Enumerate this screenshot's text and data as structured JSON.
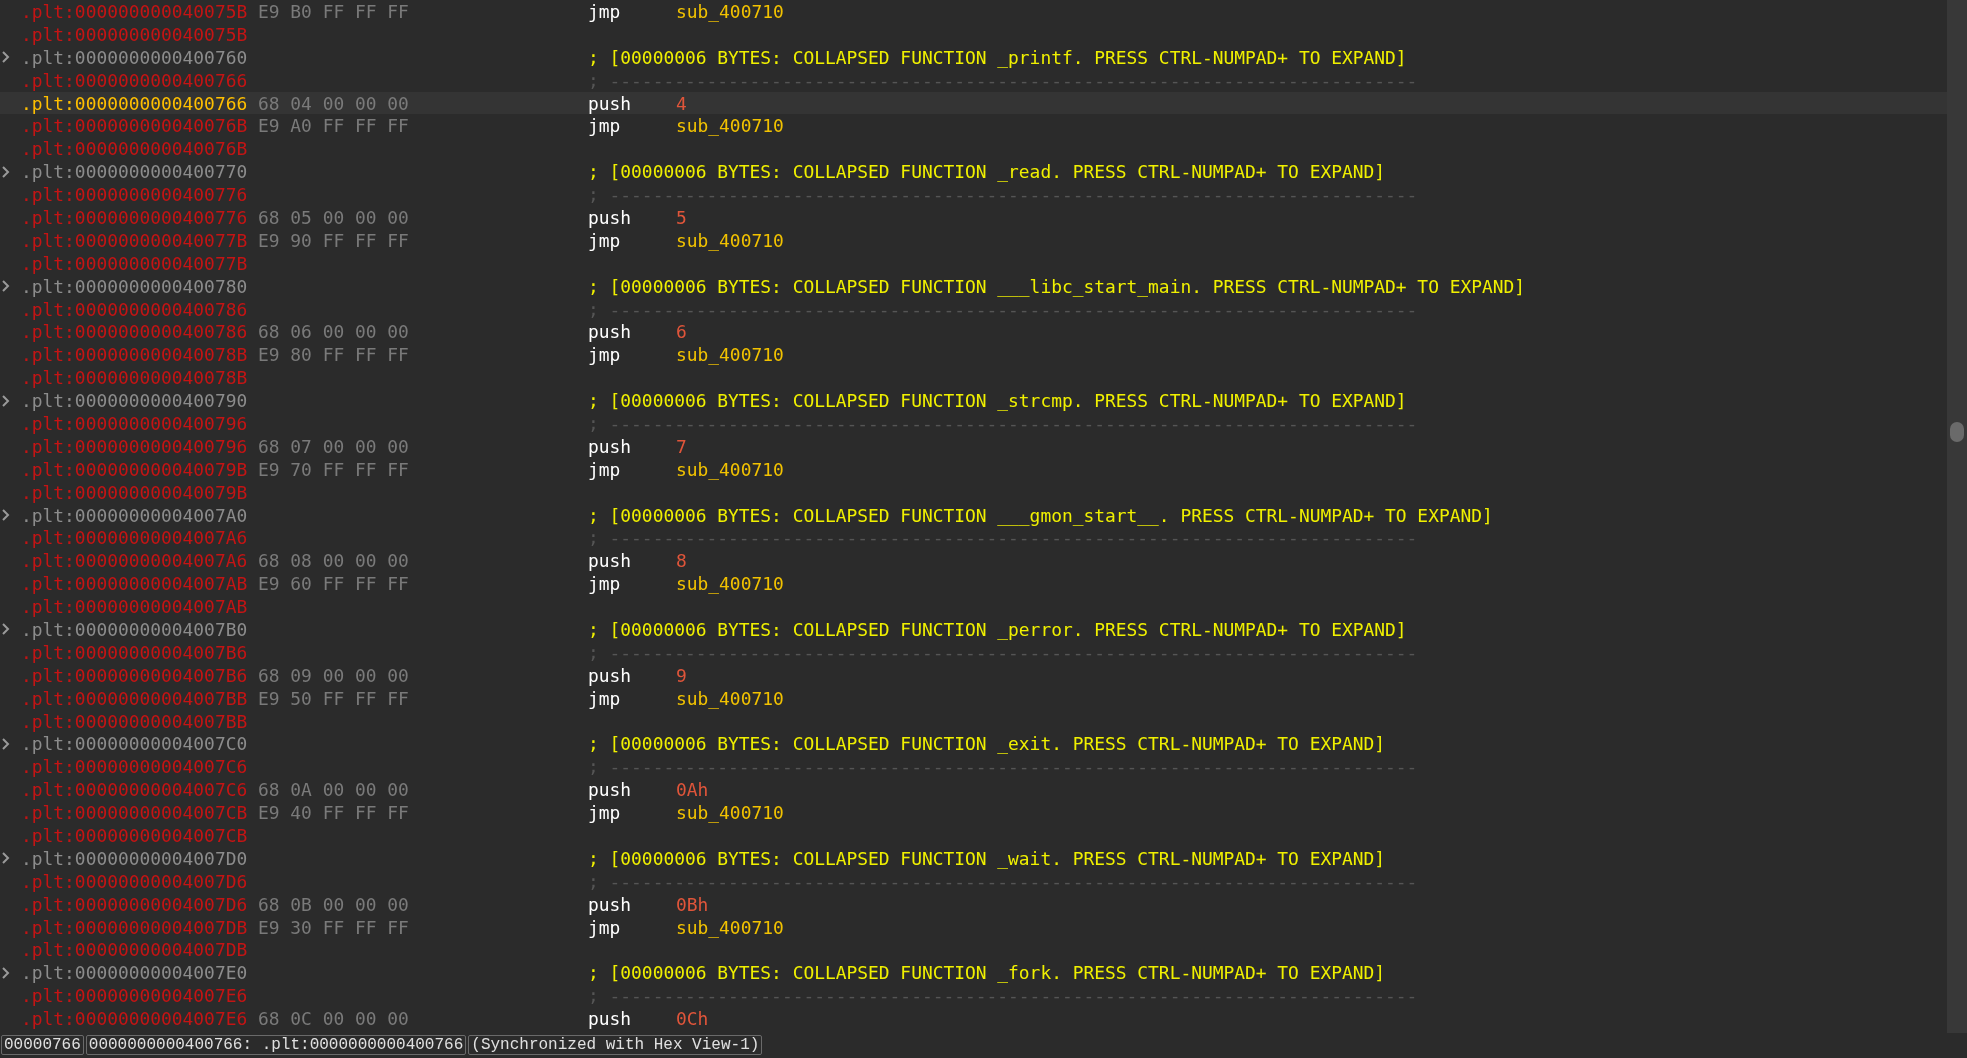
{
  "listing": {
    "rows": [
      {
        "kind": "instruction",
        "address": ".plt:000000000040075B",
        "bytes": "E9 B0 FF FF FF",
        "mnemonic": "jmp",
        "operand": {
          "kind": "name",
          "text": "sub_400710"
        },
        "selected": false
      },
      {
        "kind": "blank",
        "address": ".plt:000000000040075B",
        "selected": false
      },
      {
        "kind": "header",
        "address": ".plt:0000000000400760",
        "comment": "; [00000006 BYTES: COLLAPSED FUNCTION _printf. PRESS CTRL-NUMPAD+ TO EXPAND]",
        "selected": false
      },
      {
        "kind": "separator",
        "address": ".plt:0000000000400766",
        "comment": "; ---------------------------------------------------------------------------",
        "selected": false
      },
      {
        "kind": "instruction",
        "address": ".plt:0000000000400766",
        "bytes": "68 04 00 00 00",
        "mnemonic": "push",
        "operand": {
          "kind": "number",
          "text": "4"
        },
        "selected": true
      },
      {
        "kind": "instruction",
        "address": ".plt:000000000040076B",
        "bytes": "E9 A0 FF FF FF",
        "mnemonic": "jmp",
        "operand": {
          "kind": "name",
          "text": "sub_400710"
        },
        "selected": false
      },
      {
        "kind": "blank",
        "address": ".plt:000000000040076B",
        "selected": false
      },
      {
        "kind": "header",
        "address": ".plt:0000000000400770",
        "comment": "; [00000006 BYTES: COLLAPSED FUNCTION _read. PRESS CTRL-NUMPAD+ TO EXPAND]",
        "selected": false
      },
      {
        "kind": "separator",
        "address": ".plt:0000000000400776",
        "comment": "; ---------------------------------------------------------------------------",
        "selected": false
      },
      {
        "kind": "instruction",
        "address": ".plt:0000000000400776",
        "bytes": "68 05 00 00 00",
        "mnemonic": "push",
        "operand": {
          "kind": "number",
          "text": "5"
        },
        "selected": false
      },
      {
        "kind": "instruction",
        "address": ".plt:000000000040077B",
        "bytes": "E9 90 FF FF FF",
        "mnemonic": "jmp",
        "operand": {
          "kind": "name",
          "text": "sub_400710"
        },
        "selected": false
      },
      {
        "kind": "blank",
        "address": ".plt:000000000040077B",
        "selected": false
      },
      {
        "kind": "header",
        "address": ".plt:0000000000400780",
        "comment": "; [00000006 BYTES: COLLAPSED FUNCTION ___libc_start_main. PRESS CTRL-NUMPAD+ TO EXPAND]",
        "selected": false
      },
      {
        "kind": "separator",
        "address": ".plt:0000000000400786",
        "comment": "; ---------------------------------------------------------------------------",
        "selected": false
      },
      {
        "kind": "instruction",
        "address": ".plt:0000000000400786",
        "bytes": "68 06 00 00 00",
        "mnemonic": "push",
        "operand": {
          "kind": "number",
          "text": "6"
        },
        "selected": false
      },
      {
        "kind": "instruction",
        "address": ".plt:000000000040078B",
        "bytes": "E9 80 FF FF FF",
        "mnemonic": "jmp",
        "operand": {
          "kind": "name",
          "text": "sub_400710"
        },
        "selected": false
      },
      {
        "kind": "blank",
        "address": ".plt:000000000040078B",
        "selected": false
      },
      {
        "kind": "header",
        "address": ".plt:0000000000400790",
        "comment": "; [00000006 BYTES: COLLAPSED FUNCTION _strcmp. PRESS CTRL-NUMPAD+ TO EXPAND]",
        "selected": false
      },
      {
        "kind": "separator",
        "address": ".plt:0000000000400796",
        "comment": "; ---------------------------------------------------------------------------",
        "selected": false
      },
      {
        "kind": "instruction",
        "address": ".plt:0000000000400796",
        "bytes": "68 07 00 00 00",
        "mnemonic": "push",
        "operand": {
          "kind": "number",
          "text": "7"
        },
        "selected": false
      },
      {
        "kind": "instruction",
        "address": ".plt:000000000040079B",
        "bytes": "E9 70 FF FF FF",
        "mnemonic": "jmp",
        "operand": {
          "kind": "name",
          "text": "sub_400710"
        },
        "selected": false
      },
      {
        "kind": "blank",
        "address": ".plt:000000000040079B",
        "selected": false
      },
      {
        "kind": "header",
        "address": ".plt:00000000004007A0",
        "comment": "; [00000006 BYTES: COLLAPSED FUNCTION ___gmon_start__. PRESS CTRL-NUMPAD+ TO EXPAND]",
        "selected": false
      },
      {
        "kind": "separator",
        "address": ".plt:00000000004007A6",
        "comment": "; ---------------------------------------------------------------------------",
        "selected": false
      },
      {
        "kind": "instruction",
        "address": ".plt:00000000004007A6",
        "bytes": "68 08 00 00 00",
        "mnemonic": "push",
        "operand": {
          "kind": "number",
          "text": "8"
        },
        "selected": false
      },
      {
        "kind": "instruction",
        "address": ".plt:00000000004007AB",
        "bytes": "E9 60 FF FF FF",
        "mnemonic": "jmp",
        "operand": {
          "kind": "name",
          "text": "sub_400710"
        },
        "selected": false
      },
      {
        "kind": "blank",
        "address": ".plt:00000000004007AB",
        "selected": false
      },
      {
        "kind": "header",
        "address": ".plt:00000000004007B0",
        "comment": "; [00000006 BYTES: COLLAPSED FUNCTION _perror. PRESS CTRL-NUMPAD+ TO EXPAND]",
        "selected": false
      },
      {
        "kind": "separator",
        "address": ".plt:00000000004007B6",
        "comment": "; ---------------------------------------------------------------------------",
        "selected": false
      },
      {
        "kind": "instruction",
        "address": ".plt:00000000004007B6",
        "bytes": "68 09 00 00 00",
        "mnemonic": "push",
        "operand": {
          "kind": "number",
          "text": "9"
        },
        "selected": false
      },
      {
        "kind": "instruction",
        "address": ".plt:00000000004007BB",
        "bytes": "E9 50 FF FF FF",
        "mnemonic": "jmp",
        "operand": {
          "kind": "name",
          "text": "sub_400710"
        },
        "selected": false
      },
      {
        "kind": "blank",
        "address": ".plt:00000000004007BB",
        "selected": false
      },
      {
        "kind": "header",
        "address": ".plt:00000000004007C0",
        "comment": "; [00000006 BYTES: COLLAPSED FUNCTION _exit. PRESS CTRL-NUMPAD+ TO EXPAND]",
        "selected": false
      },
      {
        "kind": "separator",
        "address": ".plt:00000000004007C6",
        "comment": "; ---------------------------------------------------------------------------",
        "selected": false
      },
      {
        "kind": "instruction",
        "address": ".plt:00000000004007C6",
        "bytes": "68 0A 00 00 00",
        "mnemonic": "push",
        "operand": {
          "kind": "number",
          "text": "0Ah"
        },
        "selected": false
      },
      {
        "kind": "instruction",
        "address": ".plt:00000000004007CB",
        "bytes": "E9 40 FF FF FF",
        "mnemonic": "jmp",
        "operand": {
          "kind": "name",
          "text": "sub_400710"
        },
        "selected": false
      },
      {
        "kind": "blank",
        "address": ".plt:00000000004007CB",
        "selected": false
      },
      {
        "kind": "header",
        "address": ".plt:00000000004007D0",
        "comment": "; [00000006 BYTES: COLLAPSED FUNCTION _wait. PRESS CTRL-NUMPAD+ TO EXPAND]",
        "selected": false
      },
      {
        "kind": "separator",
        "address": ".plt:00000000004007D6",
        "comment": "; ---------------------------------------------------------------------------",
        "selected": false
      },
      {
        "kind": "instruction",
        "address": ".plt:00000000004007D6",
        "bytes": "68 0B 00 00 00",
        "mnemonic": "push",
        "operand": {
          "kind": "number",
          "text": "0Bh"
        },
        "selected": false
      },
      {
        "kind": "instruction",
        "address": ".plt:00000000004007DB",
        "bytes": "E9 30 FF FF FF",
        "mnemonic": "jmp",
        "operand": {
          "kind": "name",
          "text": "sub_400710"
        },
        "selected": false
      },
      {
        "kind": "blank",
        "address": ".plt:00000000004007DB",
        "selected": false
      },
      {
        "kind": "header",
        "address": ".plt:00000000004007E0",
        "comment": "; [00000006 BYTES: COLLAPSED FUNCTION _fork. PRESS CTRL-NUMPAD+ TO EXPAND]",
        "selected": false
      },
      {
        "kind": "separator",
        "address": ".plt:00000000004007E6",
        "comment": "; ---------------------------------------------------------------------------",
        "selected": false
      },
      {
        "kind": "instruction",
        "address": ".plt:00000000004007E6",
        "bytes": "68 0C 00 00 00",
        "mnemonic": "push",
        "operand": {
          "kind": "number",
          "text": "0Ch"
        },
        "selected": false
      }
    ]
  },
  "status_bar": [
    "00000766",
    "0000000000400766: .plt:0000000000400766",
    "(Synchronized with Hex View-1)"
  ]
}
